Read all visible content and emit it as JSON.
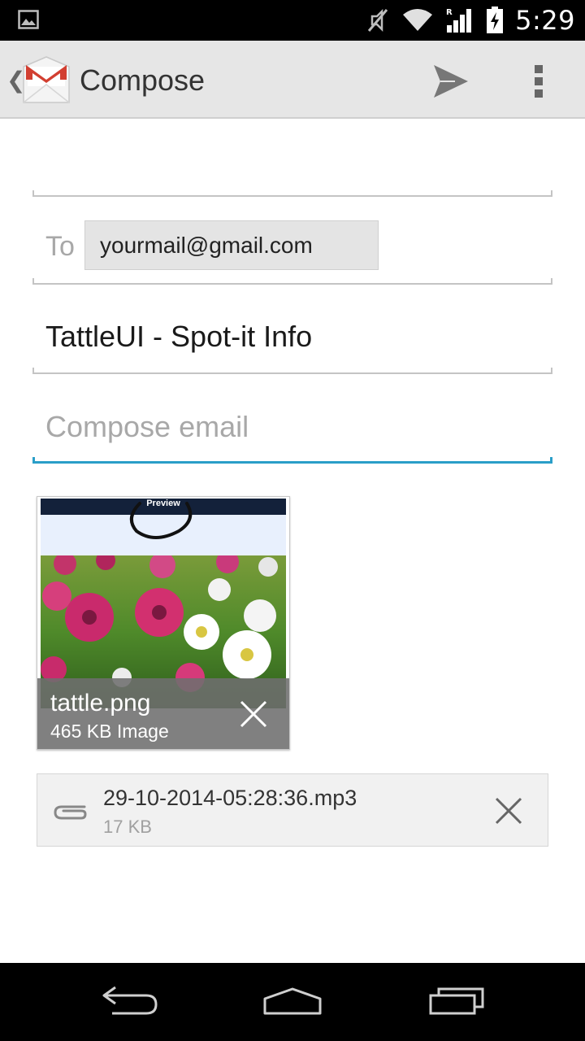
{
  "status_bar": {
    "time": "5:29",
    "icons": [
      "gallery-icon",
      "mute-icon",
      "wifi-icon",
      "signal-icon",
      "battery-charging-icon"
    ]
  },
  "action_bar": {
    "title": "Compose",
    "app_icon": "gmail-icon",
    "actions": [
      "send-icon",
      "overflow-menu-icon"
    ]
  },
  "form": {
    "to_label": "To",
    "recipient": "yourmail@gmail.com",
    "subject": "TattleUI - Spot-it Info",
    "body_placeholder": "Compose email"
  },
  "attachments": {
    "image": {
      "preview_label": "Preview",
      "name": "tattle.png",
      "size": "465 KB Image"
    },
    "file": {
      "name": "29-10-2014-05:28:36.mp3",
      "size": "17 KB"
    }
  },
  "colors": {
    "accent": "#2a9ec8",
    "action_bar": "#e6e6e6",
    "gmail_red": "#d23f31"
  },
  "nav_bar": {
    "buttons": [
      "back-icon",
      "home-icon",
      "recent-apps-icon"
    ]
  }
}
